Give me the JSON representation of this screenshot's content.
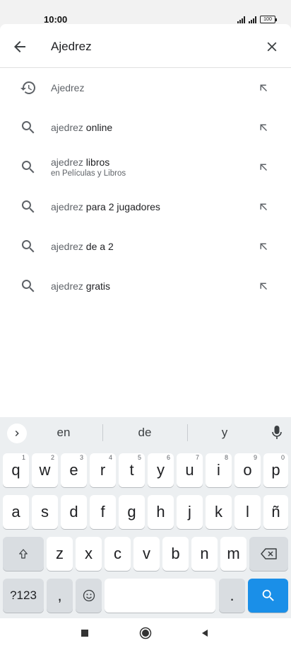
{
  "status_bar": {
    "time": "10:00",
    "battery": "100"
  },
  "search": {
    "query": "Ajedrez",
    "back_icon": "arrow-back-icon",
    "clear_icon": "close-icon"
  },
  "suggestions": [
    {
      "type": "history",
      "typed": "",
      "rest": "Ajedrez",
      "sub": ""
    },
    {
      "type": "search",
      "typed": "ajedrez",
      "rest": " online",
      "sub": ""
    },
    {
      "type": "search",
      "typed": "ajedrez",
      "rest": " libros",
      "sub": "en Películas y Libros"
    },
    {
      "type": "search",
      "typed": "ajedrez",
      "rest": " para 2 jugadores",
      "sub": ""
    },
    {
      "type": "search",
      "typed": "ajedrez",
      "rest": " de a 2",
      "sub": ""
    },
    {
      "type": "search",
      "typed": "ajedrez",
      "rest": " gratis",
      "sub": ""
    }
  ],
  "keyboard": {
    "suggestions": [
      "en",
      "de",
      "y"
    ],
    "row1": [
      "q",
      "w",
      "e",
      "r",
      "t",
      "y",
      "u",
      "i",
      "o",
      "p"
    ],
    "row1_hints": [
      "1",
      "2",
      "3",
      "4",
      "5",
      "6",
      "7",
      "8",
      "9",
      "0"
    ],
    "row2": [
      "a",
      "s",
      "d",
      "f",
      "g",
      "h",
      "j",
      "k",
      "l",
      "ñ"
    ],
    "row3": [
      "z",
      "x",
      "c",
      "v",
      "b",
      "n",
      "m"
    ],
    "symbols_label": "?123",
    "comma": ",",
    "period": ".",
    "space": ""
  },
  "colors": {
    "accent": "#1a8fe8",
    "keyboard_bg": "#eceff1"
  }
}
